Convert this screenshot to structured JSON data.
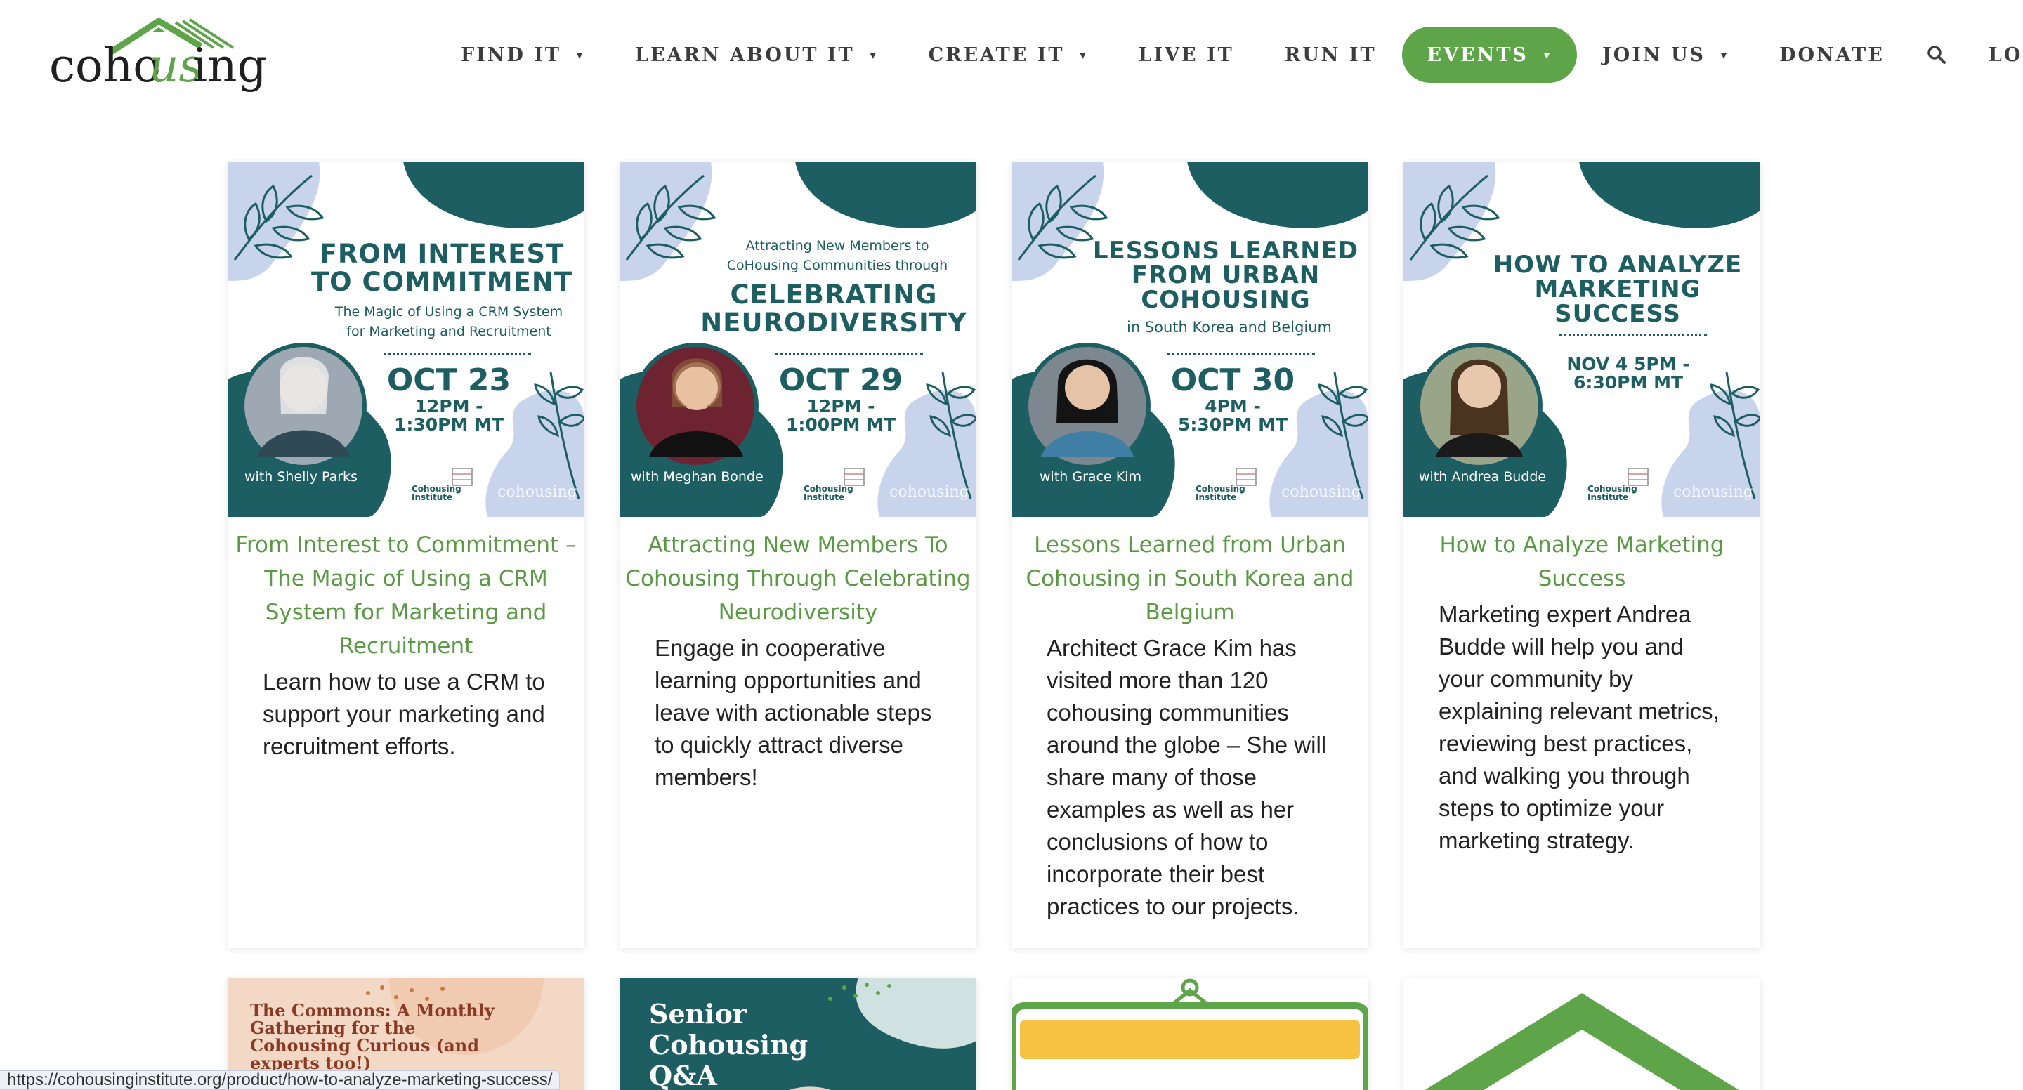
{
  "brand": {
    "logo_text": "cohousing",
    "logo_accent": "us",
    "green": "#5ea54a",
    "teal": "#1d5e63",
    "lavender": "#c8d3ec"
  },
  "nav": {
    "items": [
      {
        "label": "FIND IT",
        "caret": "▾"
      },
      {
        "label": "LEARN ABOUT IT",
        "caret": "▾"
      },
      {
        "label": "CREATE IT",
        "caret": "▾"
      },
      {
        "label": "LIVE IT"
      },
      {
        "label": "RUN IT"
      },
      {
        "label": "EVENTS",
        "caret": "▾",
        "active": true
      },
      {
        "label": "JOIN US",
        "caret": "▾"
      },
      {
        "label": "DONATE"
      }
    ],
    "search_icon": "search-icon",
    "login": "LOG IN"
  },
  "cards": [
    {
      "flyer": {
        "title_lines": [
          "FROM INTEREST",
          "TO COMMITMENT"
        ],
        "subtitle_lines": [
          "The Magic of Using a CRM System",
          "for Marketing and Recruitment"
        ],
        "date": "OCT 23",
        "time_lines": [
          "12PM -",
          "1:30PM MT"
        ],
        "presenter": "with Shelly Parks",
        "ci_lines": [
          "Cohousing",
          "Institute"
        ],
        "co_mark": "cohousing"
      },
      "title": "From Interest to Commitment – The Magic of Using a CRM System for Marketing and Recruitment",
      "description": "Learn how to use a CRM to support your marketing and recruitment efforts."
    },
    {
      "flyer": {
        "pretitle_lines": [
          "Attracting New Members to",
          "CoHousing Communities through"
        ],
        "title_lines": [
          "CELEBRATING",
          "NEURODIVERSITY"
        ],
        "date": "OCT 29",
        "time_lines": [
          "12PM -",
          "1:00PM MT"
        ],
        "presenter": "with Meghan Bonde",
        "ci_lines": [
          "Cohousing",
          "Institute"
        ],
        "co_mark": "cohousing"
      },
      "title": "Attracting New Members To Cohousing Through Celebrating Neurodiversity",
      "description": "Engage in cooperative learning opportunities and leave with actionable steps to quickly attract diverse members!"
    },
    {
      "flyer": {
        "title_lines": [
          "LESSONS LEARNED",
          "FROM URBAN",
          "COHOUSING"
        ],
        "subtitle_lines": [
          "in South Korea and Belgium"
        ],
        "date": "OCT 30",
        "time_lines": [
          "4PM -",
          "5:30PM MT"
        ],
        "presenter": "with Grace Kim",
        "ci_lines": [
          "Cohousing",
          "Institute"
        ],
        "co_mark": "cohousing"
      },
      "title": "Lessons Learned from Urban Cohousing in South Korea and Belgium",
      "description": "Architect Grace Kim has visited more than 120 cohousing communities around the globe – She will share many of those examples as well as her conclusions of how to incorporate their best practices to our projects."
    },
    {
      "flyer": {
        "title_lines": [
          "HOW TO ANALYZE",
          "MARKETING",
          "SUCCESS"
        ],
        "time_lines": [
          "NOV 4 5PM -",
          "6:30PM MT"
        ],
        "presenter": "with Andrea Budde",
        "ci_lines": [
          "Cohousing",
          "Institute"
        ],
        "co_mark": "cohousing"
      },
      "title": "How to Analyze Marketing Success",
      "description": "Marketing expert Andrea Budde will help you and your community by explaining relevant metrics, reviewing best practices, and walking you through steps to optimize your marketing strategy."
    }
  ],
  "row2": [
    {
      "flyer_text_lines": [
        "The Commons: A Monthly",
        "Gathering for the",
        "Cohousing Curious (and",
        "experts too!)"
      ]
    },
    {
      "flyer_text_lines": [
        "Senior",
        "Cohousing",
        "Q&A"
      ]
    },
    {
      "image": "calendar-icon"
    },
    {
      "image": "house-roof-icon"
    }
  ],
  "status_url": "https://cohousinginstitute.org/product/how-to-analyze-marketing-success/"
}
